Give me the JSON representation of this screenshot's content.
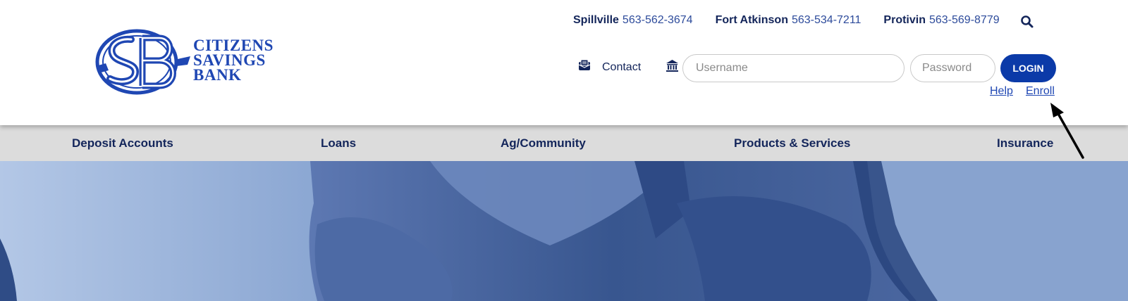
{
  "brand": {
    "name_line1": "CITIZENS",
    "name_line2": "SAVINGS",
    "name_line3": "BANK",
    "monogram": "SB",
    "color": "#1f47b3"
  },
  "phones": [
    {
      "town": "Spillville",
      "number": "563-562-3674"
    },
    {
      "town": "Fort Atkinson",
      "number": "563-534-7211"
    },
    {
      "town": "Protivin",
      "number": "563-569-8779"
    }
  ],
  "header": {
    "contact_label": "Contact",
    "search_icon": "search-icon",
    "contact_icon": "envelope-icon",
    "bank_icon": "bank-icon"
  },
  "login": {
    "username_placeholder": "Username",
    "username_value": "",
    "password_placeholder": "Password",
    "password_value": "",
    "login_label": "LOGIN",
    "help_label": "Help",
    "enroll_label": "Enroll",
    "button_color": "#0b3aa8"
  },
  "nav": {
    "items": [
      {
        "label": "Deposit Accounts"
      },
      {
        "label": "Loans"
      },
      {
        "label": "Ag/Community"
      },
      {
        "label": "Products & Services"
      },
      {
        "label": "Insurance"
      }
    ]
  },
  "colors": {
    "navy_text": "#13255a",
    "nav_bg": "#dcdcdc",
    "hero_blue": "#3d5a96"
  }
}
